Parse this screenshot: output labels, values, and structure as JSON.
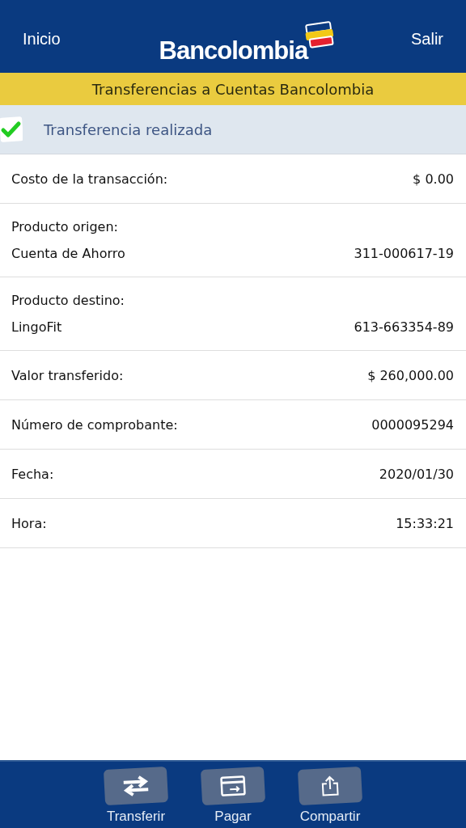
{
  "header": {
    "left_link": "Inicio",
    "logo": "Bancolombia",
    "right_link": "Salir"
  },
  "section_title": "Transferencias a Cuentas Bancolombia",
  "status": {
    "message": "Transferencia realizada",
    "success": true
  },
  "rows": [
    {
      "kind": "inline",
      "label": "Costo de la transacción:",
      "value": "$ 0.00"
    },
    {
      "kind": "stacked",
      "label": "Producto origen:",
      "detail": "Cuenta de Ahorro",
      "value": "311-000617-19"
    },
    {
      "kind": "stacked",
      "label": "Producto destino:",
      "detail": "LingoFit",
      "value": "613-663354-89"
    },
    {
      "kind": "inline",
      "label": "Valor transferido:",
      "value": "$ 260,000.00"
    },
    {
      "kind": "inline",
      "label": "Número de comprobante:",
      "value": "0000095294"
    },
    {
      "kind": "inline",
      "label": "Fecha:",
      "value": "2020/01/30"
    },
    {
      "kind": "inline",
      "label": "Hora:",
      "value": "15:33:21"
    }
  ],
  "toolbar": [
    {
      "kind": "transfer",
      "label": "Transferir"
    },
    {
      "kind": "pay",
      "label": "Pagar"
    },
    {
      "kind": "share",
      "label": "Compartir"
    }
  ]
}
